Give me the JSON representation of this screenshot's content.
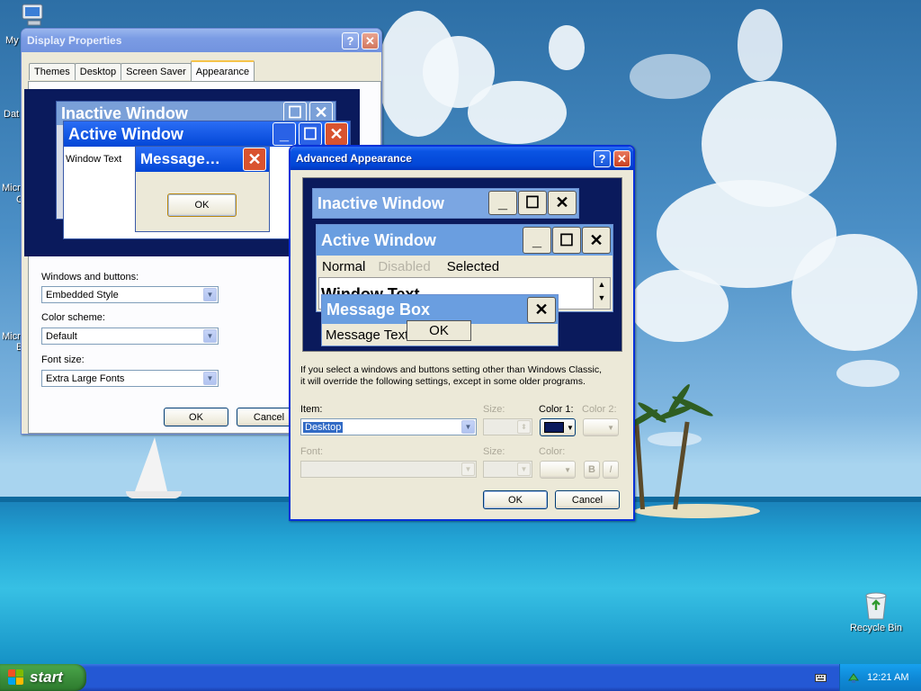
{
  "desktop": {
    "icons": [
      {
        "label": "Recycle Bin"
      }
    ],
    "partial_labels": [
      "My",
      "Dat",
      "Micro",
      "C",
      "Micro",
      "B"
    ]
  },
  "display_properties": {
    "title": "Display Properties",
    "tabs": [
      "Themes",
      "Desktop",
      "Screen Saver",
      "Appearance"
    ],
    "active_tab": "Appearance",
    "preview": {
      "inactive_title": "Inactive Window",
      "active_title": "Active Window",
      "window_text": "Window Text",
      "message_title": "Message…",
      "ok_label": "OK"
    },
    "windows_buttons_label": "Windows and buttons:",
    "windows_buttons_value": "Embedded Style",
    "color_scheme_label": "Color scheme:",
    "color_scheme_value": "Default",
    "font_size_label": "Font size:",
    "font_size_value": "Extra Large Fonts",
    "ok_label": "OK",
    "cancel_label": "Cancel"
  },
  "advanced_appearance": {
    "title": "Advanced Appearance",
    "preview": {
      "inactive_title": "Inactive Window",
      "active_title": "Active Window",
      "menu_normal": "Normal",
      "menu_disabled": "Disabled",
      "menu_selected": "Selected",
      "window_text": "Window Text",
      "message_title": "Message Box",
      "message_text": "Message Text",
      "ok_label": "OK"
    },
    "help_text_line1": "If you select a windows and buttons setting other than Windows Classic,",
    "help_text_line2": "it will override the following settings, except in some older programs.",
    "item_label": "Item:",
    "item_value": "Desktop",
    "size_label": "Size:",
    "color1_label": "Color 1:",
    "color2_label": "Color 2:",
    "font_label": "Font:",
    "font_size_label": "Size:",
    "font_color_label": "Color:",
    "bold_label": "B",
    "italic_label": "I",
    "ok_label": "OK",
    "cancel_label": "Cancel",
    "color1_swatch": "#0a1a5c"
  },
  "taskbar": {
    "start_label": "start",
    "clock": "12:21 AM"
  },
  "colors": {
    "xp_blue": "#0246d6",
    "start_green": "#3c8f3c",
    "desktop_preview_bg": "#0a1a5c",
    "preview_caption": "#6a9ee0"
  }
}
